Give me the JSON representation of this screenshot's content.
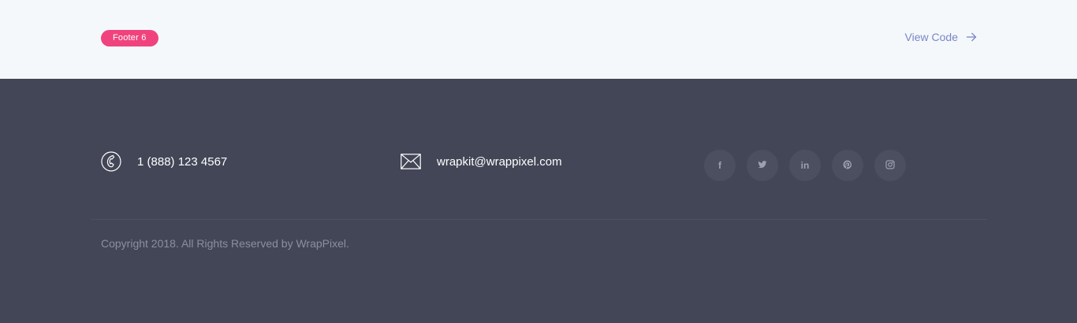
{
  "header": {
    "badge_label": "Footer 6",
    "view_code_label": "View Code",
    "badge_color": "#f0437d",
    "link_color": "#7a86c6"
  },
  "footer": {
    "phone": "1 (888) 123 4567",
    "email": "wrapkit@wrappixel.com",
    "socials": [
      {
        "name": "facebook",
        "icon": "facebook-icon",
        "glyph": "f"
      },
      {
        "name": "twitter",
        "icon": "twitter-icon",
        "glyph": ""
      },
      {
        "name": "linkedin",
        "icon": "linkedin-icon",
        "glyph": "in"
      },
      {
        "name": "pinterest",
        "icon": "pinterest-icon",
        "glyph": ""
      },
      {
        "name": "instagram",
        "icon": "instagram-icon",
        "glyph": ""
      }
    ],
    "copyright": "Copyright 2018. All Rights Reserved by WrapPixel.",
    "background_color": "#424656"
  }
}
